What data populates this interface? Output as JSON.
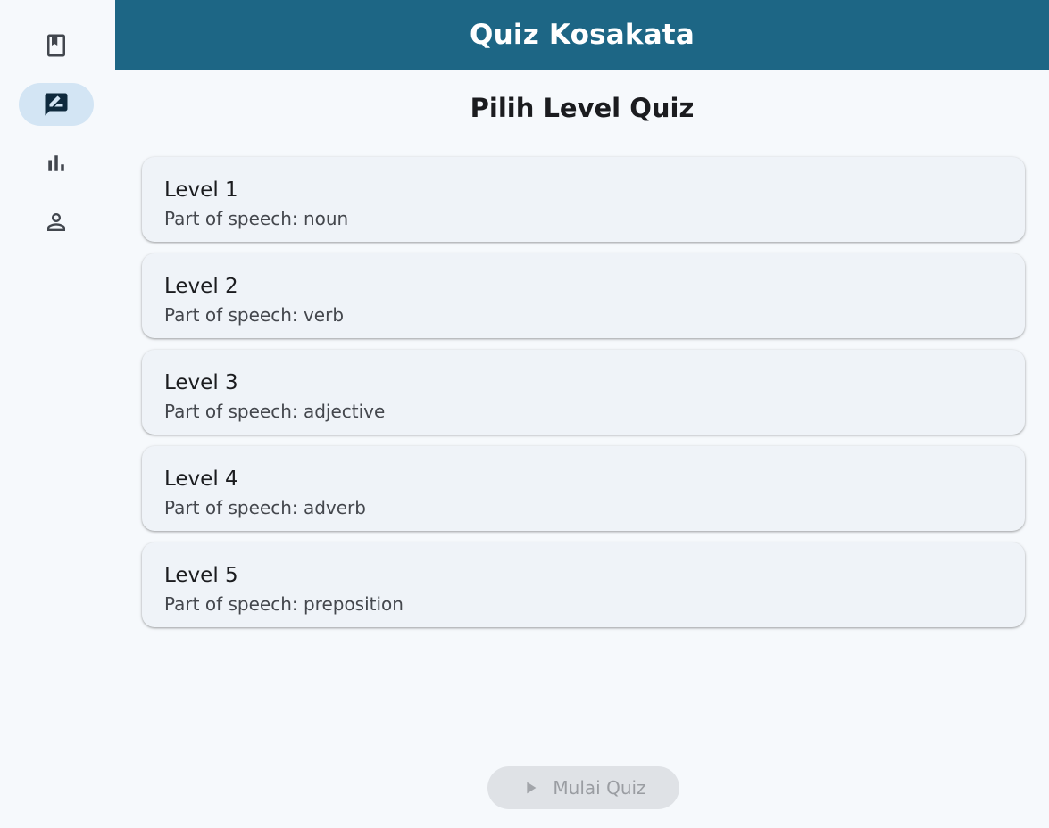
{
  "nav": {
    "items": [
      {
        "icon": "book-icon",
        "selected": false
      },
      {
        "icon": "rate-review-icon",
        "selected": true
      },
      {
        "icon": "bar-chart-icon",
        "selected": false
      },
      {
        "icon": "person-icon",
        "selected": false
      }
    ]
  },
  "appbar": {
    "title": "Quiz Kosakata"
  },
  "main": {
    "section_title": "Pilih Level Quiz",
    "levels": [
      {
        "title": "Level 1",
        "subtitle": "Part of speech: noun"
      },
      {
        "title": "Level 2",
        "subtitle": "Part of speech: verb"
      },
      {
        "title": "Level 3",
        "subtitle": "Part of speech: adjective"
      },
      {
        "title": "Level 4",
        "subtitle": "Part of speech: adverb"
      },
      {
        "title": "Level 5",
        "subtitle": "Part of speech: preposition"
      }
    ],
    "start_button": {
      "label": "Mulai Quiz",
      "icon": "play-icon",
      "enabled": false
    }
  },
  "colors": {
    "appbar": "#1d6685",
    "background": "#f6f9fc",
    "card": "#eff3f8",
    "nav_active_indicator": "#d3e5f4",
    "button_disabled": "#dfe2e6"
  }
}
